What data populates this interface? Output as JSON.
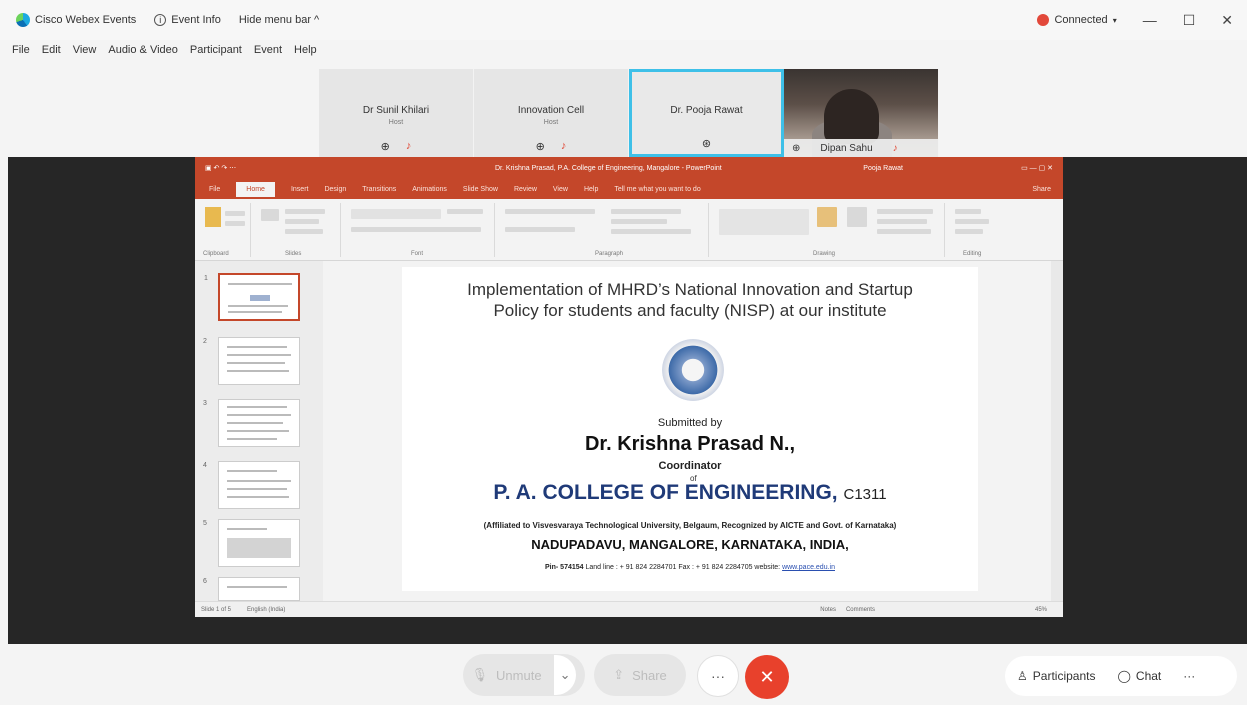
{
  "titlebar": {
    "app_name": "Cisco Webex Events",
    "event_info": "Event Info",
    "hide_menu": "Hide menu bar ^",
    "status": "Connected",
    "status_color": "#e2483a"
  },
  "menu": [
    "File",
    "Edit",
    "View",
    "Audio & Video",
    "Participant",
    "Event",
    "Help"
  ],
  "participants": [
    {
      "name": "Dr Sunil Khilari",
      "role": "Host"
    },
    {
      "name": "Innovation Cell",
      "role": "Host"
    },
    {
      "name": "Dr. Pooja Rawat",
      "role": ""
    },
    {
      "name": "Dipan Sahu",
      "role": ""
    }
  ],
  "ppt": {
    "doc_title": "Dr. Krishna Prasad, P.A. College of Engineering, Mangalore - PowerPoint",
    "user": "Pooja Rawat",
    "tabs": [
      "File",
      "Home",
      "Insert",
      "Design",
      "Transitions",
      "Animations",
      "Slide Show",
      "Review",
      "View",
      "Help",
      "Tell me what you want to do",
      "Share"
    ],
    "ribbon_groups": [
      "Clipboard",
      "Slides",
      "Font",
      "Paragraph",
      "Drawing",
      "Editing"
    ],
    "status_left": "Slide 1 of 5",
    "status_lang": "English (India)",
    "notes": "Notes",
    "comments": "Comments",
    "zoom": "45%"
  },
  "slide": {
    "title_line1": "Implementation of MHRD’s National Innovation and Startup",
    "title_line2": "Policy for students and faculty (NISP) at our institute",
    "submitted_by": "Submitted by",
    "name": "Dr. Krishna Prasad N.,",
    "coordinator": "Coordinator",
    "of": "of",
    "college": "P. A. COLLEGE OF ENGINEERING,",
    "code": "C1311",
    "affiliation": "(Affiliated to Visvesvaraya Technological University, Belgaum, Recognized by AICTE and Govt. of Karnataka)",
    "address": "NADUPADAVU, MANGALORE, KARNATAKA, INDIA,",
    "pin": "Pin- 574154",
    "contact": "Land line : + 91 824 2284701 Fax : + 91 824 2284705  website:",
    "website": "www.pace.edu.in"
  },
  "controls": {
    "unmute": "Unmute",
    "share": "Share",
    "more": "···",
    "end": "✕",
    "participants": "Participants",
    "chat": "Chat",
    "overflow": "···"
  }
}
